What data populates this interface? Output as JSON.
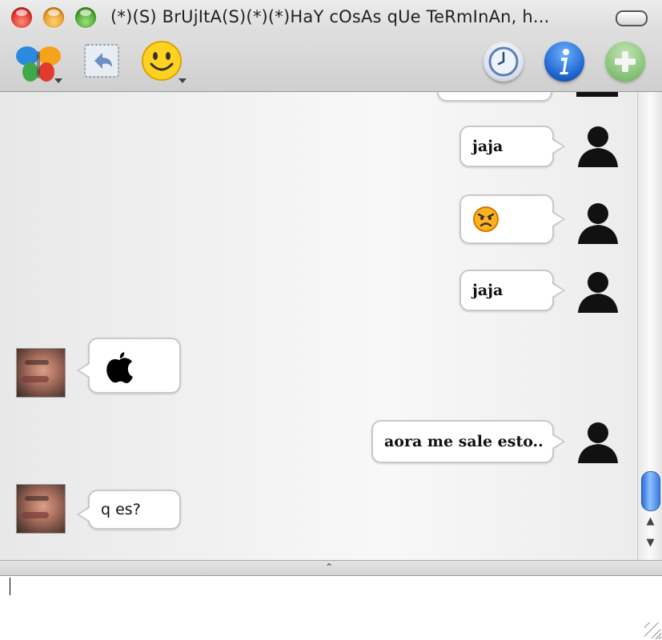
{
  "window": {
    "title": "(*)(S) BrUjItA(S)(*)(*)HaY cOsAs qUe TeRmInAn, h..."
  },
  "toolbar": {
    "icons": [
      "msn-butterfly-icon",
      "undo-icon",
      "smiley-icon",
      "clock-icon",
      "info-icon",
      "add-icon"
    ]
  },
  "messages": [
    {
      "side": "right",
      "kind": "text",
      "text": "jaja"
    },
    {
      "side": "right",
      "kind": "emoticon",
      "icon": "angry-face-icon"
    },
    {
      "side": "right",
      "kind": "text",
      "text": "jaja"
    },
    {
      "side": "left",
      "kind": "emoticon",
      "icon": "apple-logo-icon"
    },
    {
      "side": "right",
      "kind": "text",
      "text": "aora me sale esto.."
    },
    {
      "side": "left",
      "kind": "text",
      "text": "q es?"
    }
  ],
  "colors": {
    "accent_blue": "#2b6ed6",
    "close": "#d8261a",
    "minimize": "#e0901a",
    "zoom": "#3a9a22",
    "add_green": "#6fbf5a"
  }
}
